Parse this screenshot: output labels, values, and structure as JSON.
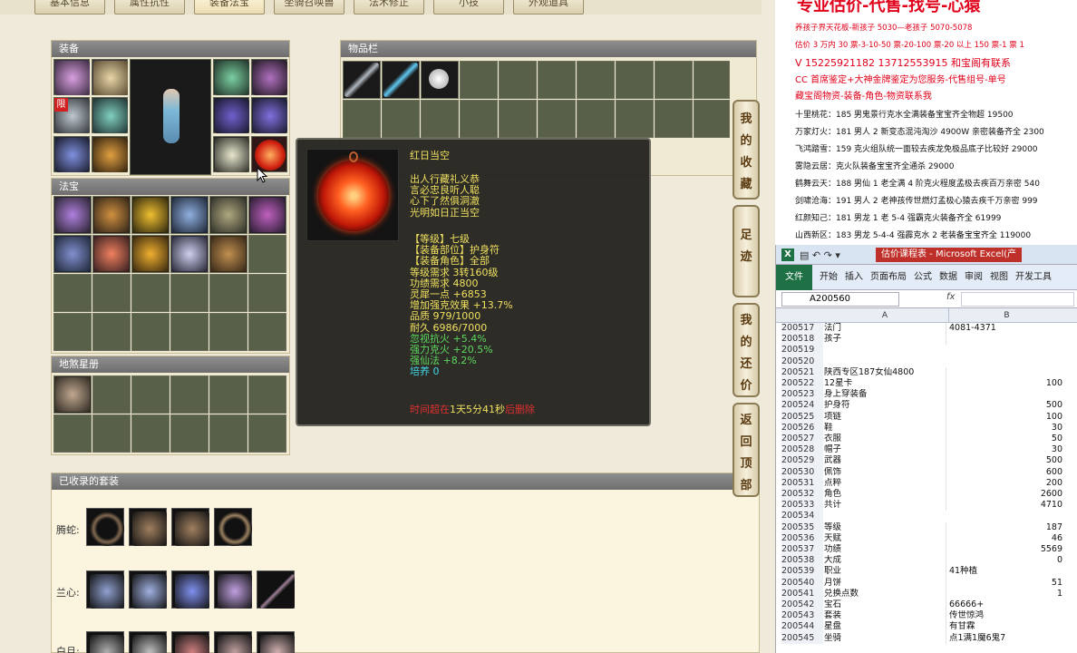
{
  "tabs": [
    "基本信息",
    "属性抗性",
    "装备法宝",
    "坐骑召唤兽",
    "法术修正",
    "小技",
    "外观道具"
  ],
  "panels": {
    "equip_title": "装备",
    "inventory_title": "物品栏",
    "treasure_title": "法宝",
    "earth_title": "地煞星册",
    "suits_title": "已收录的套装"
  },
  "equip": {
    "limited_badge": "限"
  },
  "suits": [
    {
      "label": "腾蛇:",
      "count": 4
    },
    {
      "label": "兰心:",
      "count": 5
    },
    {
      "label": "白月:",
      "count": 5
    }
  ],
  "tooltip": {
    "name": "红日当空",
    "poem": [
      "出人行藏礼义恭",
      "言必忠良听人聪",
      "心下了然俱洞澈",
      "光明如日正当空"
    ],
    "stats_yellow": [
      "【等级】七级",
      "【装备部位】护身符",
      "【装备角色】全部",
      "等级需求 3转160级",
      "功绩需求 4800",
      "灵犀一点 +6853",
      "增加强克效果 +13.7%",
      "品质 979/1000",
      "耐久 6986/7000"
    ],
    "stats_green": [
      "忽视抗火 +5.4%",
      "强力克火 +20.5%",
      "强仙法 +8.2%"
    ],
    "cultivate": "培养 0",
    "expire_prefix": "时间超在",
    "expire_value": "1天5分41秒",
    "expire_suffix": "后删除"
  },
  "side_buttons": [
    "我的收藏",
    "足迹",
    "我的还价",
    "返回顶部"
  ],
  "notes": {
    "headline": "专业估价-代售-找号-心猿",
    "red_lines": [
      "养孩子界天花板-新孩子 5030—老孩子 5070-5078",
      "估价 3 万内 30 票-3-10-50 票-20-100 票-20 以上 150 票-1 票 1",
      "V 15225921182     13712553915  和宝阁有联系",
      "CC 首席鉴定+大神金牌鉴定为您服务-代售组号-单号",
      "藏宝阁物资-装备-角色-物资联系我"
    ],
    "black_lines": [
      "十里桃花：185 男鬼景行克水全满装备宝宝齐全物超 19500",
      "万家灯火：181 男人 2 新变态混沌淘沙 4900W 亲密装备齐全 2300",
      "飞鸿踏雪：159 克火组队统一面较去疾龙免极品底子比较好 29000",
      "雾隐云居：克火队装备宝宝齐全通杀 29000",
      "鹤舞云天：188 男仙 1 老全满 4 阶克火程度孟极去疾百万亲密 540",
      "剑啸沧海：191 男人 2 老神孩传世燃灯孟极心猿去疾千万亲密 999",
      "红颜知己：181 男龙 1 老 5-4 强霸克火装备齐全 61999",
      "山西新区：183 男龙 5-4-4 强霹克水 2 老装备宝宝齐全 119000"
    ]
  },
  "excel": {
    "title": "估价课程表 - Microsoft Excel(产",
    "ribbon_tabs": [
      "文件",
      "开始",
      "插入",
      "页面布局",
      "公式",
      "数据",
      "审阅",
      "视图",
      "开发工具"
    ],
    "name_box": "A200560",
    "fx": "fx",
    "col_a": "A",
    "col_b": "B",
    "rows": [
      {
        "n": "200517",
        "a": "法门",
        "b": "4081-4371",
        "num": false
      },
      {
        "n": "200518",
        "a": "孩子",
        "b": "",
        "num": false
      },
      {
        "n": "200519",
        "a": "",
        "b": "",
        "num": false
      },
      {
        "n": "200520",
        "a": "",
        "b": "",
        "num": false
      },
      {
        "n": "200521",
        "a": "陕西专区187女仙4800",
        "b": "",
        "num": false
      },
      {
        "n": "200522",
        "a": "12星卡",
        "b": "100",
        "num": true
      },
      {
        "n": "200523",
        "a": "身上穿装备",
        "b": "",
        "num": false
      },
      {
        "n": "200524",
        "a": "护身符",
        "b": "500",
        "num": true
      },
      {
        "n": "200525",
        "a": "项链",
        "b": "100",
        "num": true
      },
      {
        "n": "200526",
        "a": "鞋",
        "b": "30",
        "num": true
      },
      {
        "n": "200527",
        "a": "衣服",
        "b": "50",
        "num": true
      },
      {
        "n": "200528",
        "a": "帽子",
        "b": "30",
        "num": true
      },
      {
        "n": "200529",
        "a": "武器",
        "b": "500",
        "num": true
      },
      {
        "n": "200530",
        "a": "佩饰",
        "b": "600",
        "num": true
      },
      {
        "n": "200531",
        "a": "点粹",
        "b": "200",
        "num": true
      },
      {
        "n": "200532",
        "a": "角色",
        "b": "2600",
        "num": true
      },
      {
        "n": "200533",
        "a": "共计",
        "b": "4710",
        "num": true
      },
      {
        "n": "200534",
        "a": "",
        "b": "",
        "num": false
      },
      {
        "n": "200535",
        "a": "等级",
        "b": "187",
        "num": true
      },
      {
        "n": "200536",
        "a": "天赋",
        "b": "46",
        "num": true
      },
      {
        "n": "200537",
        "a": "功绩",
        "b": "5569",
        "num": true
      },
      {
        "n": "200538",
        "a": "大成",
        "b": "0",
        "num": true
      },
      {
        "n": "200539",
        "a": "职业",
        "b": "41种植",
        "num": false
      },
      {
        "n": "200540",
        "a": "月饼",
        "b": "51",
        "num": true
      },
      {
        "n": "200541",
        "a": "兑换点数",
        "b": "1",
        "num": true
      },
      {
        "n": "200542",
        "a": "宝石",
        "b": "66666+",
        "num": false
      },
      {
        "n": "200543",
        "a": "套装",
        "b": "传世惊鸿",
        "num": false
      },
      {
        "n": "200544",
        "a": "星盘",
        "b": "有甘霖",
        "num": false
      },
      {
        "n": "200545",
        "a": "坐骑",
        "b": "点1满1魔6鬼7",
        "num": false
      }
    ]
  },
  "colors": {
    "tooltip_yellow": "#f0e060",
    "tooltip_green": "#5ed85e",
    "tooltip_cyan": "#40d8e8",
    "notes_red": "#e0001a",
    "excel_green": "#1e7145"
  }
}
